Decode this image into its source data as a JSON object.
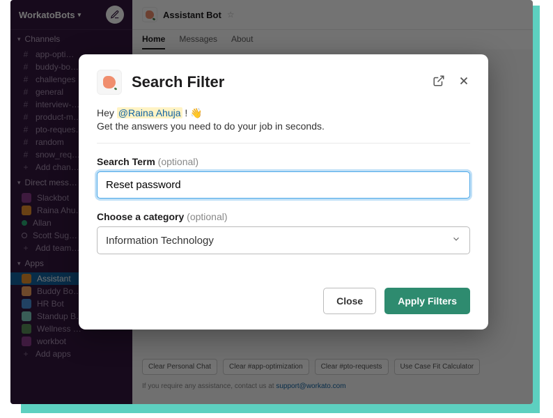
{
  "workspace": {
    "name": "WorkatoBots"
  },
  "sidebar": {
    "channels_label": "Channels",
    "channels": [
      {
        "name": "app-opti…"
      },
      {
        "name": "buddy-bo…"
      },
      {
        "name": "challenges"
      },
      {
        "name": "general"
      },
      {
        "name": "interview-…"
      },
      {
        "name": "product-m…"
      },
      {
        "name": "pto-reques…"
      },
      {
        "name": "random"
      },
      {
        "name": "snow_req…"
      }
    ],
    "add_channel": "Add chan…",
    "dm_label": "Direct mess…",
    "dms": [
      {
        "name": "Slackbot"
      },
      {
        "name": "Raina Ahu…"
      },
      {
        "name": "Allan"
      },
      {
        "name": "Scott Sug…"
      }
    ],
    "add_teammate": "Add team…",
    "apps_label": "Apps",
    "apps": [
      {
        "name": "Assistant"
      },
      {
        "name": "Buddy Bo…"
      },
      {
        "name": "HR Bot"
      },
      {
        "name": "Standup B…"
      },
      {
        "name": "Wellness …"
      },
      {
        "name": "workbot"
      }
    ],
    "add_apps": "Add apps"
  },
  "header": {
    "app_name": "Assistant Bot",
    "tabs": [
      "Home",
      "Messages",
      "About"
    ]
  },
  "bottom_actions": [
    "Clear Personal Chat",
    "Clear #app-optimization",
    "Clear #pto-requests",
    "Use Case Fit Calculator"
  ],
  "footer": {
    "text": "If you require any assistance, contact us at ",
    "link": "support@workato.com"
  },
  "modal": {
    "title": "Search Filter",
    "greeting_prefix": "Hey ",
    "mention": "@Raina Ahuja",
    "greeting_suffix": " ! 👋",
    "subtext": "Get the answers you need to do your job in seconds.",
    "search_label": "Search Term",
    "optional": "(optional)",
    "search_value": "Reset password",
    "category_label": "Choose a category",
    "category_value": "Information Technology",
    "close": "Close",
    "apply": "Apply Filters"
  }
}
